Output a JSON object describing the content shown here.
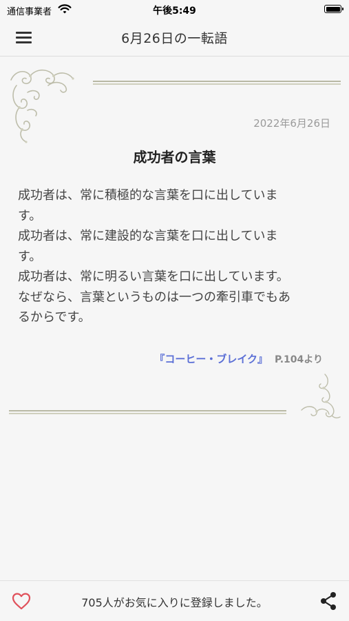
{
  "status_bar": {
    "carrier": "通信事業者",
    "time": "午後5:49",
    "icons": [
      "wifi-icon",
      "battery-icon"
    ]
  },
  "nav": {
    "title": "6月26日の一転語",
    "menu_icon": "hamburger-menu-icon"
  },
  "quote": {
    "date": "2022年6月26日",
    "title": "成功者の言葉",
    "body": "成功者は、常に積極的な言葉を口に出していま\nす。\n成功者は、常に建設的な言葉を口に出していま\nす。\n成功者は、常に明るい言葉を口に出しています。\nなぜなら、言葉というものは一つの牽引車でもあ\nるからです。",
    "source_book": "『コーヒー・ブレイク』",
    "source_page": "P.104より"
  },
  "footer": {
    "favorites_text": "705人がお気に入りに登録しました。",
    "heart_icon": "heart-icon",
    "share_icon": "share-icon"
  },
  "colors": {
    "background": "#f6f6f6",
    "link": "#5b6fd6",
    "heart": "#e0505a",
    "ornament": "#b8b8a4"
  }
}
